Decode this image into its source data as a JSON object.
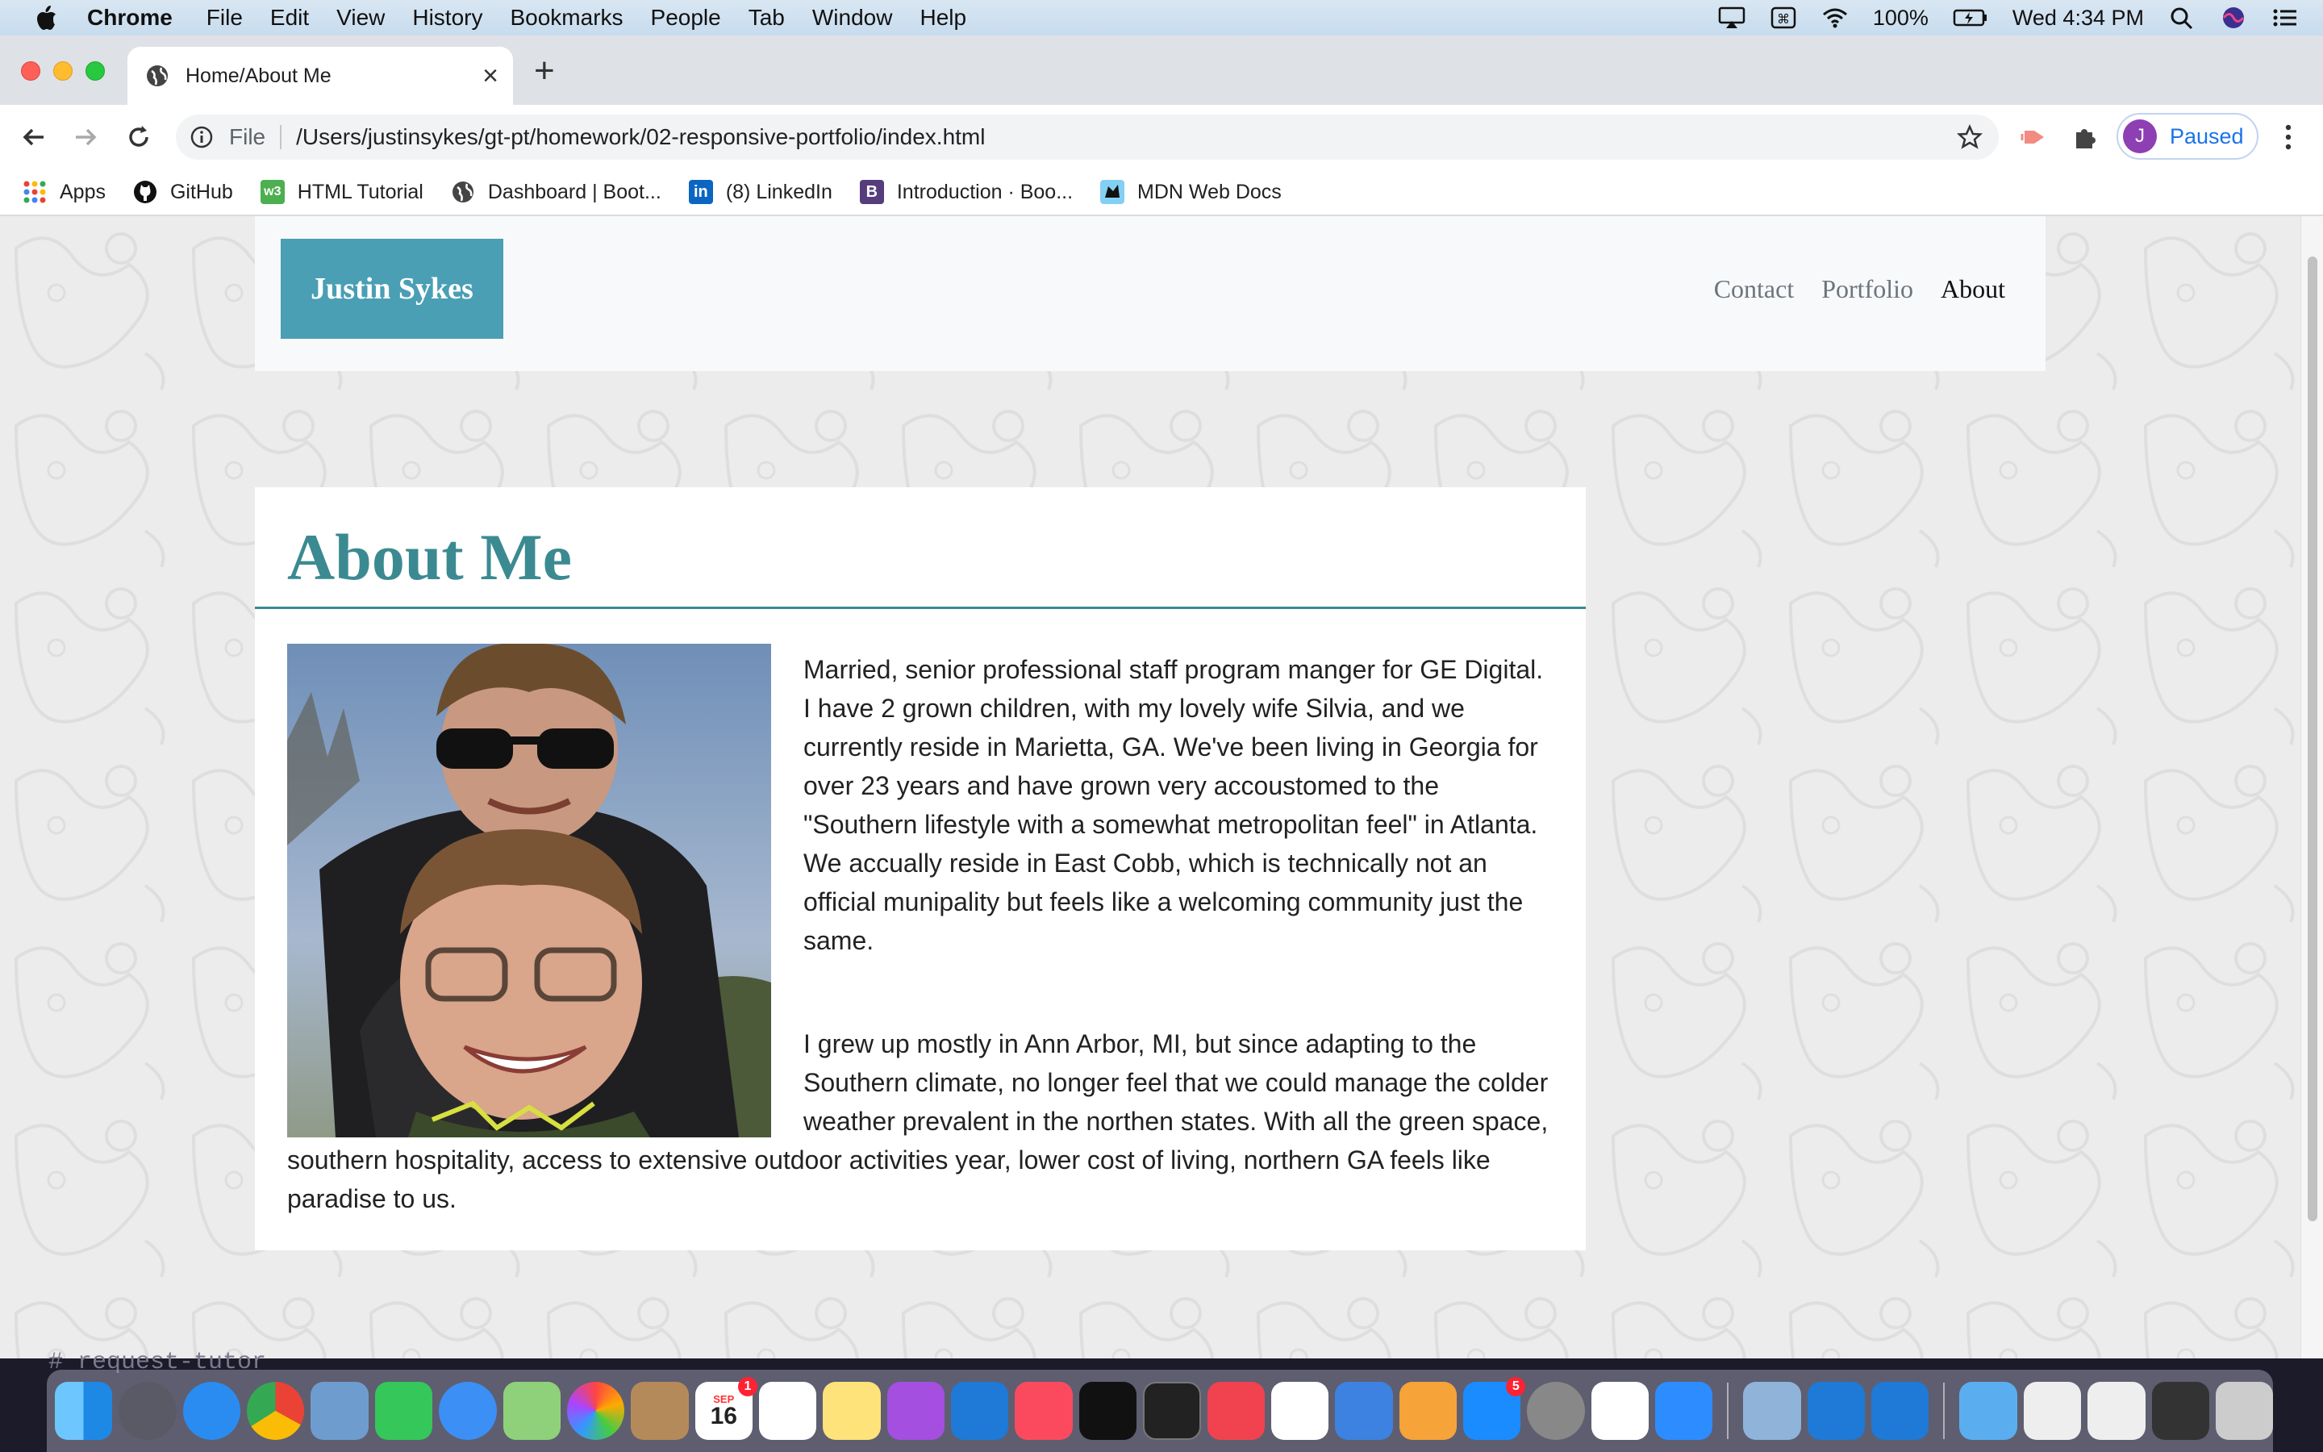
{
  "menubar": {
    "app_name": "Chrome",
    "items": [
      "File",
      "Edit",
      "View",
      "History",
      "Bookmarks",
      "People",
      "Tab",
      "Window",
      "Help"
    ],
    "battery": "100%",
    "clock": "Wed 4:34 PM"
  },
  "browser": {
    "tab_title": "Home/About Me",
    "omnibox_scheme": "File",
    "omnibox_url": "/Users/justinsykes/gt-pt/homework/02-responsive-portfolio/index.html",
    "profile_initial": "J",
    "profile_status": "Paused",
    "bookmarks": [
      {
        "label": "Apps",
        "icon": "apps-grid-icon"
      },
      {
        "label": "GitHub",
        "icon": "github-icon"
      },
      {
        "label": "HTML Tutorial",
        "icon": "w3schools-icon"
      },
      {
        "label": "Dashboard | Boot...",
        "icon": "globe-icon"
      },
      {
        "label": "(8) LinkedIn",
        "icon": "linkedin-icon"
      },
      {
        "label": "Introduction · Boo...",
        "icon": "bootstrap-icon"
      },
      {
        "label": "MDN Web Docs",
        "icon": "mdn-icon"
      }
    ]
  },
  "site": {
    "brand": "Justin Sykes",
    "nav": [
      {
        "label": "Contact",
        "active": false
      },
      {
        "label": "Portfolio",
        "active": false
      },
      {
        "label": "About",
        "active": true
      }
    ],
    "heading": "About Me",
    "photo": "portrait-photo",
    "paragraphs": [
      "Married, senior professional staff program manger for GE Digital. I have 2 grown children, with my lovely wife Silvia, and we currently reside in Marietta, GA. We've been living in Georgia for over 23 years and have grown very accoustomed to the \"Southern lifestyle with a somewhat metropolitan feel\" in Atlanta. We accually reside in East Cobb, which is technically not an official munipality but feels like a welcoming community just the same.",
      "I grew up mostly in Ann Arbor, MI, but since adapting to the Southern climate, no longer feel that we could manage the colder weather prevalent in the northen states. With all the green space, southern hospitality, access to extensive outdoor activities year, lower cost of living, northern GA feels like paradise to us."
    ],
    "colors": {
      "brand_bg": "#4a9fb5",
      "heading": "#3c8a91"
    }
  },
  "terminal_text": "#   request-tutor",
  "dock": {
    "calendar_day": "16",
    "calendar_month": "SEP",
    "calendar_badge": "1",
    "appstore_badge": "5",
    "apps": [
      "Finder",
      "Launchpad",
      "Safari",
      "Chrome",
      "Mail",
      "FaceTime",
      "Messages",
      "Maps",
      "Photos",
      "Contacts",
      "Calendar",
      "Reminders",
      "Notes",
      "Podcasts",
      "VS Code",
      "Music",
      "TV",
      "Terminal",
      "News",
      "Numbers",
      "Keynote",
      "Pages",
      "App Store",
      "System Preferences",
      "Slack",
      "Zoom"
    ]
  }
}
